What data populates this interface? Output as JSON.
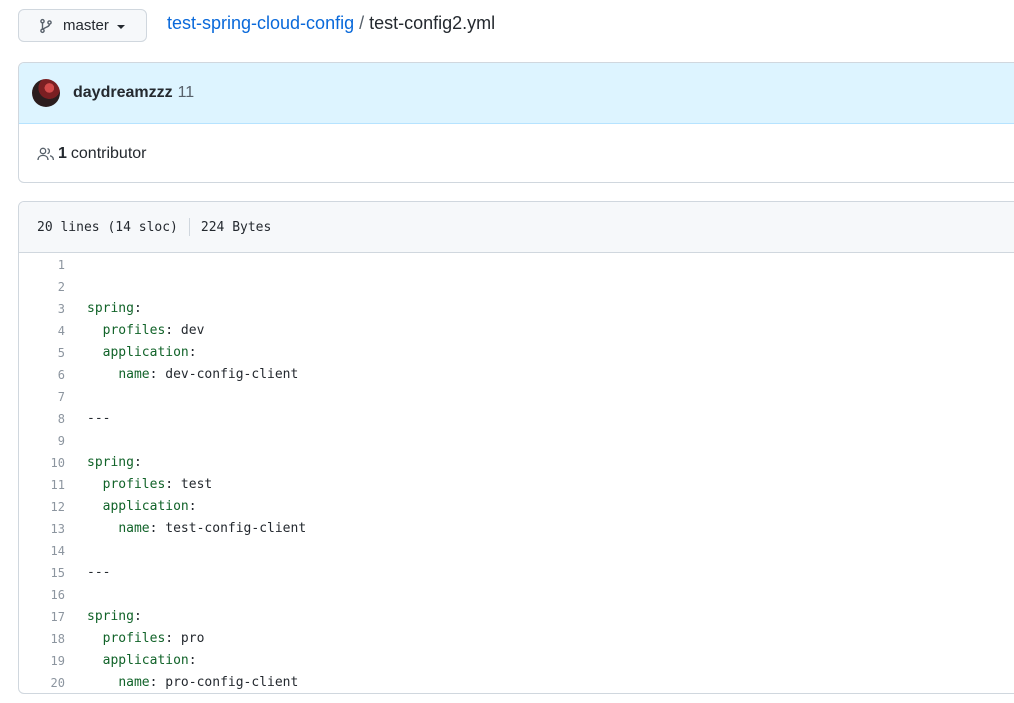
{
  "branch": {
    "label": "master",
    "icon": "git-branch-icon"
  },
  "breadcrumb": {
    "repo": "test-spring-cloud-config",
    "separator": "/",
    "file": "test-config2.yml"
  },
  "commit": {
    "author": "daydreamzzz",
    "message": "11"
  },
  "contributors": {
    "count": "1",
    "label": "contributor",
    "icon": "people-icon"
  },
  "file_info": {
    "lines": "20 lines (14 sloc)",
    "size": "224 Bytes"
  },
  "code_lines": [
    {
      "n": "1",
      "indent": "",
      "key": "",
      "colon": "",
      "value": ""
    },
    {
      "n": "2",
      "indent": "",
      "key": "",
      "colon": "",
      "value": ""
    },
    {
      "n": "3",
      "indent": "",
      "key": "spring",
      "colon": ":",
      "value": ""
    },
    {
      "n": "4",
      "indent": "  ",
      "key": "profiles",
      "colon": ":",
      "value": " dev"
    },
    {
      "n": "5",
      "indent": "  ",
      "key": "application",
      "colon": ":",
      "value": ""
    },
    {
      "n": "6",
      "indent": "    ",
      "key": "name",
      "colon": ":",
      "value": " dev-config-client"
    },
    {
      "n": "7",
      "indent": "",
      "key": "",
      "colon": "",
      "value": ""
    },
    {
      "n": "8",
      "indent": "",
      "key": "",
      "colon": "",
      "value": "---"
    },
    {
      "n": "9",
      "indent": "",
      "key": "",
      "colon": "",
      "value": ""
    },
    {
      "n": "10",
      "indent": "",
      "key": "spring",
      "colon": ":",
      "value": ""
    },
    {
      "n": "11",
      "indent": "  ",
      "key": "profiles",
      "colon": ":",
      "value": " test"
    },
    {
      "n": "12",
      "indent": "  ",
      "key": "application",
      "colon": ":",
      "value": ""
    },
    {
      "n": "13",
      "indent": "    ",
      "key": "name",
      "colon": ":",
      "value": " test-config-client"
    },
    {
      "n": "14",
      "indent": "",
      "key": "",
      "colon": "",
      "value": ""
    },
    {
      "n": "15",
      "indent": "",
      "key": "",
      "colon": "",
      "value": "---"
    },
    {
      "n": "16",
      "indent": "",
      "key": "",
      "colon": "",
      "value": ""
    },
    {
      "n": "17",
      "indent": "",
      "key": "spring",
      "colon": ":",
      "value": ""
    },
    {
      "n": "18",
      "indent": "  ",
      "key": "profiles",
      "colon": ":",
      "value": " pro"
    },
    {
      "n": "19",
      "indent": "  ",
      "key": "application",
      "colon": ":",
      "value": ""
    },
    {
      "n": "20",
      "indent": "    ",
      "key": "name",
      "colon": ":",
      "value": " pro-config-client"
    }
  ]
}
